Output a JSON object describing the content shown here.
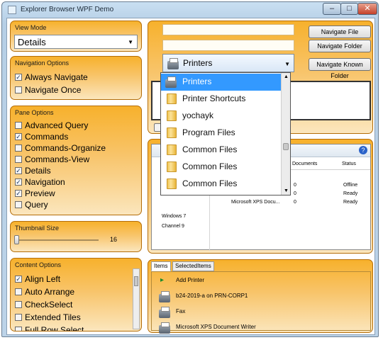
{
  "window": {
    "title": "Explorer Browser WPF Demo",
    "controls": {
      "minimize": "–",
      "maximize": "□",
      "close": "✕"
    }
  },
  "view_mode": {
    "title": "View Mode",
    "selected": "Details"
  },
  "navigation_options": {
    "title": "Navigation Options",
    "items": [
      {
        "label": "Always Navigate",
        "checked": true
      },
      {
        "label": "Navigate Once",
        "checked": false
      }
    ]
  },
  "pane_options": {
    "title": "Pane Options",
    "items": [
      {
        "label": "Advanced Query",
        "checked": false
      },
      {
        "label": "Commands",
        "checked": true
      },
      {
        "label": "Commands-Organize",
        "checked": false
      },
      {
        "label": "Commands-View",
        "checked": false
      },
      {
        "label": "Details",
        "checked": true
      },
      {
        "label": "Navigation",
        "checked": true
      },
      {
        "label": "Preview",
        "checked": true
      },
      {
        "label": "Query",
        "checked": false
      }
    ]
  },
  "thumbnail_size": {
    "title": "Thumbnail Size",
    "value": "16"
  },
  "content_options": {
    "title": "Content Options",
    "items": [
      {
        "label": "Align Left",
        "checked": true
      },
      {
        "label": "Auto Arrange",
        "checked": false
      },
      {
        "label": "CheckSelect",
        "checked": false
      },
      {
        "label": "Extended Tiles",
        "checked": false
      },
      {
        "label": "Full Row Select",
        "checked": false
      }
    ]
  },
  "navigation": {
    "navigate_file": "Navigate File",
    "navigate_folder": "Navigate Folder",
    "navigate_known_folder": "Navigate Known Folder",
    "known_folder_selected": "Printers",
    "dropdown_items": [
      "Printers",
      "Printer Shortcuts",
      "yochayk",
      "Program Files",
      "Common Files",
      "Common Files",
      "Common Files"
    ]
  },
  "browser": {
    "tree_items": [
      "Windows 7",
      "Channel 9"
    ],
    "columns": [
      "Documents",
      "Status"
    ],
    "rows": [
      {
        "name": "",
        "documents": "0",
        "status": "Offline"
      },
      {
        "name": "",
        "documents": "0",
        "status": "Ready"
      },
      {
        "name": "Microsoft XPS Docu...",
        "documents": "0",
        "status": "Ready"
      }
    ],
    "help_icon": "?"
  },
  "items_panel": {
    "tabs": [
      "Items",
      "SelectedItems"
    ],
    "items": [
      {
        "label": "Add Printer",
        "icon": "add-printer-icon"
      },
      {
        "label": "b24-2019-a on PRN-CORP1",
        "icon": "network-printer-icon"
      },
      {
        "label": "Fax",
        "icon": "fax-icon"
      },
      {
        "label": "Microsoft XPS Document Writer",
        "icon": "printer-icon"
      }
    ]
  }
}
